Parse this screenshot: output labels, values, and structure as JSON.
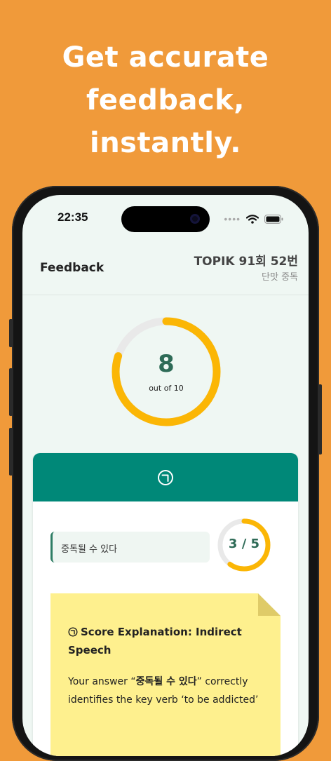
{
  "headline": {
    "line1": "Get accurate",
    "line2": "feedback,",
    "line3": "instantly."
  },
  "status_bar": {
    "time": "22:35",
    "icons": [
      "signal-dots-icon",
      "wifi-icon",
      "battery-icon"
    ]
  },
  "header": {
    "title": "Feedback",
    "exam_title": "TOPIK 91회 52번",
    "exam_subtitle": "단맛 중독"
  },
  "score": {
    "value": "8",
    "label": "out of 10",
    "fraction": 0.8,
    "color": "#FBB605",
    "track_color": "#E9E9E9"
  },
  "card": {
    "header_color": "#008878",
    "header_icon": "giyeok-circle-icon",
    "answer": "중독될 수 있다",
    "sub_score": "3 / 5",
    "sub_fraction": 0.6,
    "note": {
      "title": "Score Explanation: Indirect Speech",
      "body_prefix": "Your answer “",
      "body_bold": "중독될 수 있다",
      "body_suffix": "” correctly identifies the key verb ‘to be addicted’"
    }
  }
}
